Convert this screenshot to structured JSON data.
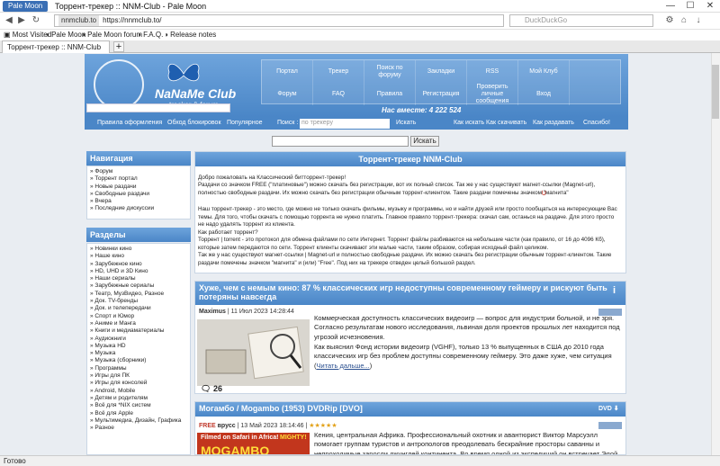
{
  "browser": {
    "app_button": "Pale Moon",
    "title": "Торрент-трекер :: NNM-Club - Pale Moon",
    "url_host": "nnmclub.to",
    "url": "https://nnmclub.to/",
    "search_placeholder": "DuckDuckGo",
    "bookmarks": [
      "Most Visited",
      "Pale Moon",
      "Pale Moon forum",
      "F.A.Q.",
      "Release notes"
    ],
    "tab_title": "Торрент-трекер :: NNM-Club",
    "status": "Готово",
    "win_min": "—",
    "win_max": "☐",
    "win_close": "✕",
    "back": "◀",
    "forward": "▶",
    "reload": "↻",
    "new_tab": "+"
  },
  "site": {
    "logo_title": "NaNaMe Club",
    "logo_subtitle": "tracker & forum",
    "online": "Нас вместе: 4 222 524",
    "menu_row1": [
      "Портал",
      "Трекер",
      "Поиск по форуму",
      "Закладки",
      "RSS",
      "Мой Клуб"
    ],
    "menu_row2": [
      "Форум",
      "FAQ",
      "Правила",
      "Регистрация",
      "Проверить личные сообщения",
      "Вход"
    ],
    "linkbar": [
      "Правила оформления",
      "Обход блокировок",
      "Популярное",
      "Поиск :",
      "Искать",
      "Как искать",
      "Как скачивать",
      "Как раздавать",
      "Спасибо!"
    ],
    "search_placeholder": "по трекеру",
    "search_button": "Искать",
    "nav_heading": "Навигация",
    "nav_items": [
      "Форум",
      "Торрент портал",
      "Новые раздачи",
      "Свободные раздачи",
      "Вчера",
      "Последние дискуссии"
    ],
    "sections_heading": "Разделы",
    "sections": [
      "Новинки кино",
      "Наше кино",
      "Зарубежное кино",
      "HD, UHD и 3D Кино",
      "Наши сериалы",
      "Зарубежные сериалы",
      "Театр, МузВидео, Разное",
      "Док. TV-бренды",
      "Док. и телепередачи",
      "Спорт и Юмор",
      "Аниме и Манга",
      "Книги и медиаматериалы",
      "Аудиокниги",
      "Музыка HD",
      "Музыка",
      "Музыка (сборники)",
      "Программы",
      "Игры для ПК",
      "Игры для консолей",
      "Android, Mobile",
      "Детям и родителям",
      "Всё для *NIX систем",
      "Всё для Apple",
      "Мультимедиа, Дизайн, Графика",
      "Разное"
    ]
  },
  "welcome": {
    "heading": "Торрент-трекер NNM-Club",
    "p1": "Добро пожаловать на Классический битторрент-трекер!",
    "p2": "Раздачи со значком FREE (\"платиновые\") можно скачать без регистрации, вот их полный список. Так же у нас существуют магнет-ссылки (Magnet-url), полностью свободные раздачи. Их можно скачать без регистрации обычным торрент-клиентом. Такие раздачи помечены значком \"магнита\"",
    "p3": "Наш торрент-трекер - это место, где можно не только скачать фильмы, музыку и программы, но и найти друзей или просто пообщаться на интересующие Вас темы. Для того, чтобы скачать с помощью торрента не нужно платить. Главное правило торрент-трекера: скачал сам, останься на раздаче. Для этого просто не надо удалять торрент из клиента.",
    "p4": "Как работает торрент?",
    "p5": "Торрент | torrent - это протокол для обмена файлами по сети Интернет. Торрент файлы разбиваются на небольшие части (как правило, от 16 до 4096 Кб), которые затем передаются по сети. Торрент клиенты скачивают эти малые части, таким образом, собирая исходный файл целиком.",
    "p6": "Так же у нас существуют магнет-ссылки | Magnet-url и полностью свободные раздачи. Их можно скачать без регистрации обычным торрент-клиентом. Такие раздачи помечены значком \"магнита\" и (или) \"Free\". Под них на трекере отведен целый большой раздел."
  },
  "post1": {
    "title": "Хуже, чем с немым кино: 87 % классических игр недоступны современному геймеру и рискуют быть потеряны навсегда",
    "author": "Maximus",
    "date": "| 11 Июл 2023 14:28:44",
    "text1": "Коммерческая доступность классических видеоигр — вопрос для индустрии больной, и не зря. Согласно результатам нового исследования, львиная доля проектов прошлых лет находится под угрозой исчезновения.",
    "text2": "Как выяснил Фонд истории видеоигр (VGHF), только 13 % выпущенных в США до 2010 года классических игр без проблем доступны современному геймеру. Это даже хуже, чем ситуация (",
    "read_more": "Читать дальше...",
    "comments": "26"
  },
  "post2": {
    "title": "Могамбо / Mogambo (1953) DVDRip [DVO]",
    "badge": "FREE",
    "author": "врусс",
    "date": "| 13 Май 2023 18:14:46 |",
    "stars": "★★★★★",
    "poster_caption": "Filmed on Safari in Africa!",
    "poster_title": "MOGAMBO",
    "poster_mighty": "MIGHTY!",
    "text": "Кения, центральная Африка. Профессиональный охотник и авантюрист Виктор Марсуэлл помогает группам туристов и антропологов преодолевать бескрайние просторы саванны и непроходимые заросли джунглей континента. Во время одной из экспедиций он встречает Элой, танцовщицу из"
  }
}
